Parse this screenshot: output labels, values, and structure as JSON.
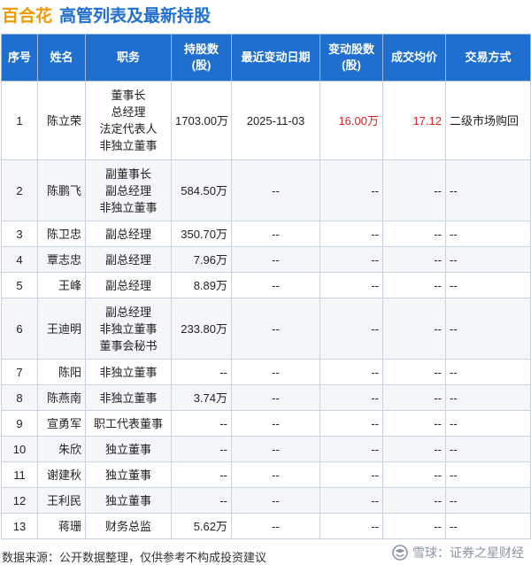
{
  "title": {
    "company": "百合花",
    "subtitle": "高管列表及最新持股"
  },
  "table": {
    "headers": {
      "seq": "序号",
      "name": "姓名",
      "position": "职务",
      "holding_l1": "持股数",
      "holding_l2": "(股)",
      "last_date": "最近变动日期",
      "change_l1": "变动股数",
      "change_l2": "(股)",
      "avg_price": "成交均价",
      "method": "交易方式"
    },
    "rows": [
      {
        "seq": "1",
        "name": "陈立荣",
        "positions": [
          "董事长",
          "总经理",
          "法定代表人",
          "非独立董事"
        ],
        "holding": "1703.00万",
        "date": "2025-11-03",
        "change": "16.00万",
        "price": "17.12",
        "method": "二级市场购回"
      },
      {
        "seq": "2",
        "name": "陈鹏飞",
        "positions": [
          "副董事长",
          "副总经理",
          "非独立董事"
        ],
        "holding": "584.50万",
        "date": "--",
        "change": "--",
        "price": "--",
        "method": "--"
      },
      {
        "seq": "3",
        "name": "陈卫忠",
        "positions": [
          "副总经理"
        ],
        "holding": "350.70万",
        "date": "--",
        "change": "--",
        "price": "--",
        "method": "--"
      },
      {
        "seq": "4",
        "name": "覃志忠",
        "positions": [
          "副总经理"
        ],
        "holding": "7.96万",
        "date": "--",
        "change": "--",
        "price": "--",
        "method": "--"
      },
      {
        "seq": "5",
        "name": "王峰",
        "positions": [
          "副总经理"
        ],
        "holding": "8.89万",
        "date": "--",
        "change": "--",
        "price": "--",
        "method": "--"
      },
      {
        "seq": "6",
        "name": "王迪明",
        "positions": [
          "副总经理",
          "非独立董事",
          "董事会秘书"
        ],
        "holding": "233.80万",
        "date": "--",
        "change": "--",
        "price": "--",
        "method": "--"
      },
      {
        "seq": "7",
        "name": "陈阳",
        "positions": [
          "非独立董事"
        ],
        "holding": "--",
        "date": "--",
        "change": "--",
        "price": "--",
        "method": "--"
      },
      {
        "seq": "8",
        "name": "陈燕南",
        "positions": [
          "非独立董事"
        ],
        "holding": "3.74万",
        "date": "--",
        "change": "--",
        "price": "--",
        "method": "--"
      },
      {
        "seq": "9",
        "name": "宣勇军",
        "positions": [
          "职工代表董事"
        ],
        "holding": "--",
        "date": "--",
        "change": "--",
        "price": "--",
        "method": "--"
      },
      {
        "seq": "10",
        "name": "朱欣",
        "positions": [
          "独立董事"
        ],
        "holding": "--",
        "date": "--",
        "change": "--",
        "price": "--",
        "method": "--"
      },
      {
        "seq": "11",
        "name": "谢建秋",
        "positions": [
          "独立董事"
        ],
        "holding": "--",
        "date": "--",
        "change": "--",
        "price": "--",
        "method": "--"
      },
      {
        "seq": "12",
        "name": "王利民",
        "positions": [
          "独立董事"
        ],
        "holding": "--",
        "date": "--",
        "change": "--",
        "price": "--",
        "method": "--"
      },
      {
        "seq": "13",
        "name": "蒋珊",
        "positions": [
          "财务总监"
        ],
        "holding": "5.62万",
        "date": "--",
        "change": "--",
        "price": "--",
        "method": "--"
      }
    ]
  },
  "footer": {
    "source": "数据来源：公开数据整理，仅供参考不构成投资建议",
    "brand": "雪球：证券之星财经",
    "brand_icon": "snowball-icon"
  },
  "colors": {
    "company": "#f39800",
    "subtitle": "#1e6fd0",
    "header_bg": "#1f6fd1",
    "highlight": "#e02020"
  }
}
